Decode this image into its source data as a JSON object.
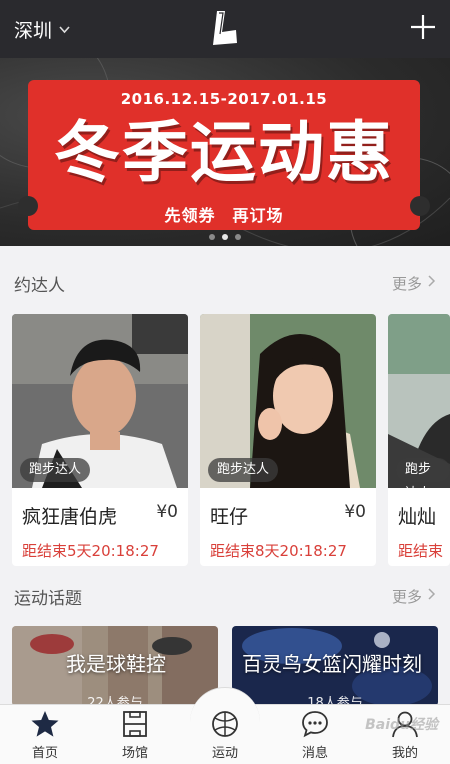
{
  "header": {
    "city": "深圳",
    "logo_icon": "l-logo-icon",
    "add_icon": "plus-icon"
  },
  "banner": {
    "date_range": "2016.12.15-2017.01.15",
    "title": "冬季运动惠",
    "subtitle": "先领券　再订场",
    "slide_count": 3,
    "active_slide": 2,
    "colors": {
      "ticket": "#e0302a",
      "background": "#2b2b2b"
    }
  },
  "people_section": {
    "title": "约达人",
    "more": "更多",
    "cards": [
      {
        "tag": "跑步达人",
        "name": "疯狂唐伯虎",
        "price": "¥0",
        "countdown": "距结束5天20:18:27"
      },
      {
        "tag": "跑步达人",
        "name": "旺仔",
        "price": "¥0",
        "countdown": "距结束8天20:18:27"
      },
      {
        "tag": "跑步达人",
        "name": "灿灿",
        "price": "",
        "countdown": "距结束"
      }
    ]
  },
  "topics_section": {
    "title": "运动话题",
    "more": "更多",
    "cards": [
      {
        "title": "我是球鞋控",
        "participants": "22人参与"
      },
      {
        "title": "百灵鸟女篮闪耀时刻",
        "participants": "18人参与"
      }
    ]
  },
  "bottom_nav": {
    "items": [
      {
        "label": "首页",
        "icon": "star-icon",
        "active": true
      },
      {
        "label": "场馆",
        "icon": "venue-icon",
        "active": false
      },
      {
        "label": "运动",
        "icon": "ball-icon",
        "active": false
      },
      {
        "label": "消息",
        "icon": "chat-icon",
        "active": false
      },
      {
        "label": "我的",
        "icon": "user-icon",
        "active": false
      }
    ]
  },
  "watermark": "Baidu经验"
}
